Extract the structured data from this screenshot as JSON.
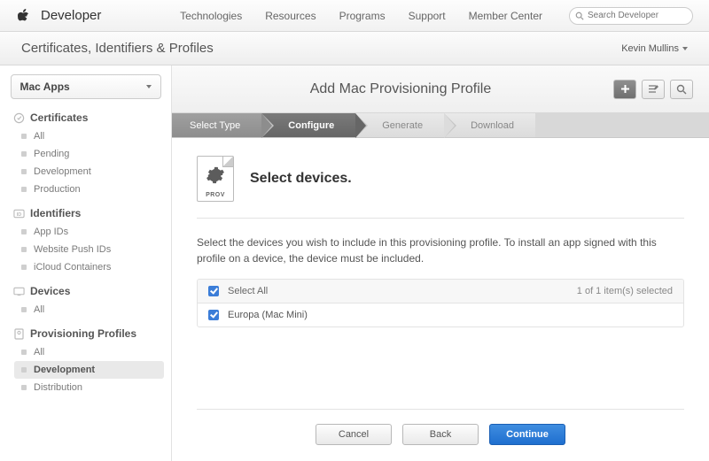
{
  "topnav": {
    "brand": "Developer",
    "links": [
      "Technologies",
      "Resources",
      "Programs",
      "Support",
      "Member Center"
    ],
    "search_placeholder": "Search Developer"
  },
  "subheader": {
    "title": "Certificates, Identifiers & Profiles",
    "user": "Kevin Mullins"
  },
  "sidebar": {
    "platform": "Mac Apps",
    "groups": [
      {
        "label": "Certificates",
        "icon": "badge",
        "items": [
          "All",
          "Pending",
          "Development",
          "Production"
        ]
      },
      {
        "label": "Identifiers",
        "icon": "id",
        "items": [
          "App IDs",
          "Website Push IDs",
          "iCloud Containers"
        ]
      },
      {
        "label": "Devices",
        "icon": "device",
        "items": [
          "All"
        ]
      },
      {
        "label": "Provisioning Profiles",
        "icon": "profile",
        "items": [
          "All",
          "Development",
          "Distribution"
        ]
      }
    ],
    "active": {
      "group": 3,
      "item": 1
    }
  },
  "content": {
    "title": "Add Mac Provisioning Profile",
    "steps": [
      "Select Type",
      "Configure",
      "Generate",
      "Download"
    ],
    "active_step": 1,
    "prov_label": "PROV",
    "heading": "Select devices.",
    "instructions": "Select the devices you wish to include in this provisioning profile. To install an app signed with this profile on a device, the device must be included.",
    "select_all_label": "Select All",
    "selection_count": "1 of 1 item(s) selected",
    "devices": [
      {
        "name": "Europa (Mac Mini)",
        "checked": true
      }
    ],
    "buttons": {
      "cancel": "Cancel",
      "back": "Back",
      "continue": "Continue"
    }
  }
}
